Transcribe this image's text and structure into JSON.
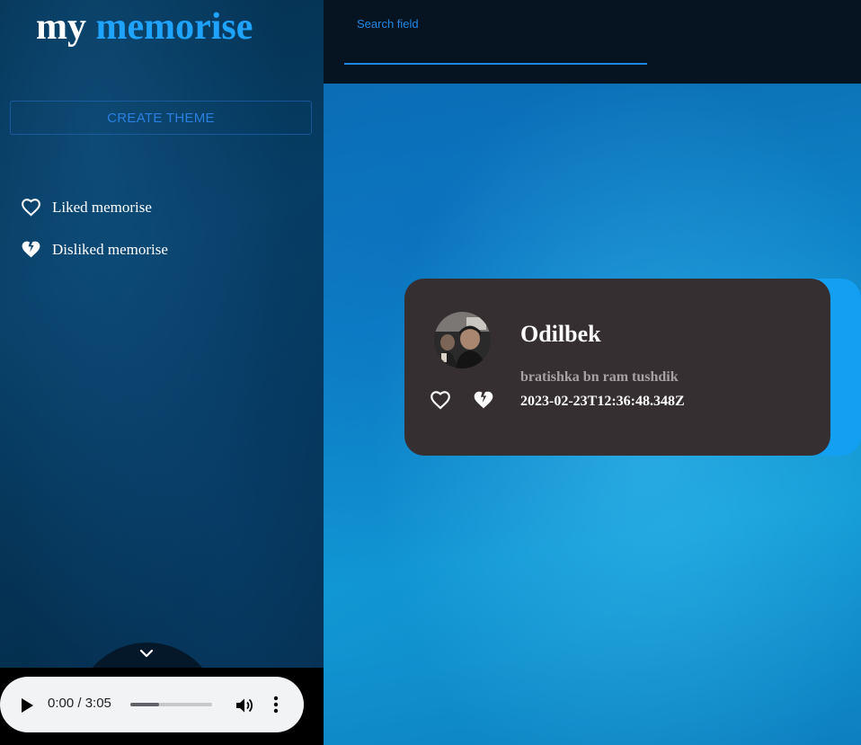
{
  "logo": {
    "part1": "my",
    "part2": "memorise"
  },
  "sidebar": {
    "create_button": "CREATE THEME",
    "items": [
      {
        "label": "Liked memorise",
        "icon": "heart-outline-icon"
      },
      {
        "label": "Disliked memorise",
        "icon": "broken-heart-icon"
      }
    ],
    "toggle_icon": "chevron-down-icon"
  },
  "audio": {
    "time": "0:00 / 3:05",
    "progress": 0.35,
    "icons": [
      "play-icon",
      "volume-icon",
      "more-vert-icon"
    ]
  },
  "search": {
    "label": "Search field",
    "value": ""
  },
  "card": {
    "name": "Odilbek",
    "message": "bratishka bn ram tushdik",
    "date": "2023-02-23T12:36:48.348Z",
    "accent_color": "#13a0f2",
    "background_color": "#362f31"
  },
  "colors": {
    "brand": "#1ea3ff",
    "accent": "#1e88e5"
  }
}
